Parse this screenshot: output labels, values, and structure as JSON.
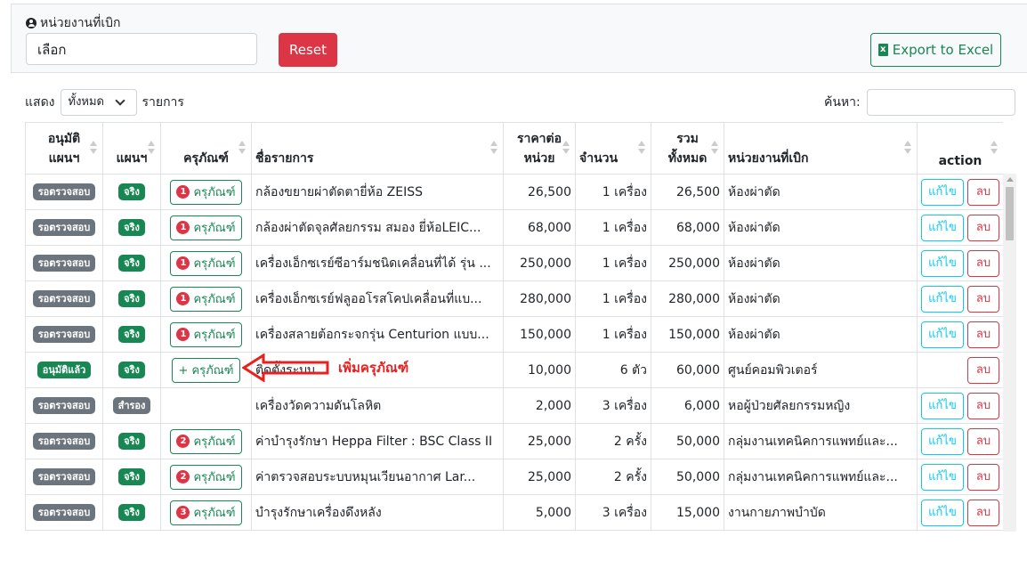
{
  "filter": {
    "department_label": "หน่วยงานที่เบิก",
    "department_value": "เลือก",
    "reset_label": "Reset",
    "export_label": "Export to Excel"
  },
  "length": {
    "prefix": "แสดง",
    "value": "ทั้งหมด",
    "suffix": "รายการ"
  },
  "search": {
    "label": "ค้นหา:"
  },
  "columns": [
    "อนุมัติ",
    "แผนฯ",
    "แผนฯ",
    "ครุภัณฑ์",
    "ชื่อรายการ",
    "ราคาต่อ",
    "หน่วย",
    "จำนวน",
    "รวม",
    "ทั้งหมด",
    "หน่วยงานที่เบิก",
    "action"
  ],
  "rows": [
    {
      "status": "รอตรวจสอบ",
      "status_color": "#6c757d",
      "plan": "จริง",
      "plan_color": "#198754",
      "eq_count": "1",
      "eq_label": "ครุภัณฑ์",
      "name": "กล้องขยายผ่าตัดตายี่ห้อ ZEISS",
      "price": "26,500",
      "qty": "1 เครื่อง",
      "total": "26,500",
      "dept": "ห้องผ่าตัด",
      "edit": "แก้ไข",
      "del": "ลบ"
    },
    {
      "status": "รอตรวจสอบ",
      "status_color": "#6c757d",
      "plan": "จริง",
      "plan_color": "#198754",
      "eq_count": "1",
      "eq_label": "ครุภัณฑ์",
      "name": "กล้องผ่าตัดจุลศัลยกรรม สมอง ยี่ห้อLEIC...",
      "price": "68,000",
      "qty": "1 เครื่อง",
      "total": "68,000",
      "dept": "ห้องผ่าตัด",
      "edit": "แก้ไข",
      "del": "ลบ"
    },
    {
      "status": "รอตรวจสอบ",
      "status_color": "#6c757d",
      "plan": "จริง",
      "plan_color": "#198754",
      "eq_count": "1",
      "eq_label": "ครุภัณฑ์",
      "name": "เครื่องเอ็กซเรย์ซีอาร์มชนิดเคลื่อนที่ได้ รุ่น ...",
      "price": "250,000",
      "qty": "1 เครื่อง",
      "total": "250,000",
      "dept": "ห้องผ่าตัด",
      "edit": "แก้ไข",
      "del": "ลบ"
    },
    {
      "status": "รอตรวจสอบ",
      "status_color": "#6c757d",
      "plan": "จริง",
      "plan_color": "#198754",
      "eq_count": "1",
      "eq_label": "ครุภัณฑ์",
      "name": "เครื่องเอ็กซเรย์ฟลูออโรสโคปเคลื่อนที่แบ...",
      "price": "280,000",
      "qty": "1 เครื่อง",
      "total": "280,000",
      "dept": "ห้องผ่าตัด",
      "edit": "แก้ไข",
      "del": "ลบ"
    },
    {
      "status": "รอตรวจสอบ",
      "status_color": "#6c757d",
      "plan": "จริง",
      "plan_color": "#198754",
      "eq_count": "1",
      "eq_label": "ครุภัณฑ์",
      "name": "เครื่องสลายต้อกระจกรุ่น Centurion แบบ...",
      "price": "150,000",
      "qty": "1 เครื่อง",
      "total": "150,000",
      "dept": "ห้องผ่าตัด",
      "edit": "แก้ไข",
      "del": "ลบ"
    },
    {
      "status": "อนุมัติแล้ว",
      "status_color": "#198754",
      "plan": "จริง",
      "plan_color": "#198754",
      "eq_count": "",
      "eq_label": "+ ครุภัณฑ์",
      "name": "ติดตั้งระบบ",
      "price": "10,000",
      "qty": "6 ตัว",
      "total": "60,000",
      "dept": "ศูนย์คอมพิวเตอร์",
      "edit": "",
      "del": "ลบ"
    },
    {
      "status": "รอตรวจสอบ",
      "status_color": "#6c757d",
      "plan": "สำรอง",
      "plan_color": "#6c757d",
      "eq_count": "",
      "eq_label": "",
      "name": "เครื่องวัดความดันโลหิต",
      "price": "2,000",
      "qty": "3 เครื่อง",
      "total": "6,000",
      "dept": "หอผู้ป่วยศัลยกรรมหญิง",
      "edit": "แก้ไข",
      "del": "ลบ"
    },
    {
      "status": "รอตรวจสอบ",
      "status_color": "#6c757d",
      "plan": "จริง",
      "plan_color": "#198754",
      "eq_count": "2",
      "eq_label": "ครุภัณฑ์",
      "name": "ค่าบำรุงรักษา Heppa Filter : BSC Class II",
      "price": "25,000",
      "qty": "2 ครั้ง",
      "total": "50,000",
      "dept": "กลุ่มงานเทคนิคการแพทย์และ...",
      "edit": "แก้ไข",
      "del": "ลบ"
    },
    {
      "status": "รอตรวจสอบ",
      "status_color": "#6c757d",
      "plan": "จริง",
      "plan_color": "#198754",
      "eq_count": "2",
      "eq_label": "ครุภัณฑ์",
      "name": "ค่าตรวจสอบระบบหมุนเวียนอากาศ Lar...",
      "price": "25,000",
      "qty": "2 ครั้ง",
      "total": "50,000",
      "dept": "กลุ่มงานเทคนิคการแพทย์และ...",
      "edit": "แก้ไข",
      "del": "ลบ"
    },
    {
      "status": "รอตรวจสอบ",
      "status_color": "#6c757d",
      "plan": "จริง",
      "plan_color": "#198754",
      "eq_count": "3",
      "eq_label": "ครุภัณฑ์",
      "name": "บำรุงรักษาเครื่องดึงหลัง",
      "price": "5,000",
      "qty": "3 เครื่อง",
      "total": "15,000",
      "dept": "งานกายภาพบำบัด",
      "edit": "แก้ไข",
      "del": "ลบ"
    }
  ],
  "annotation": {
    "text": "เพิ่มครุภัณฑ์",
    "color": "#e8201f"
  }
}
